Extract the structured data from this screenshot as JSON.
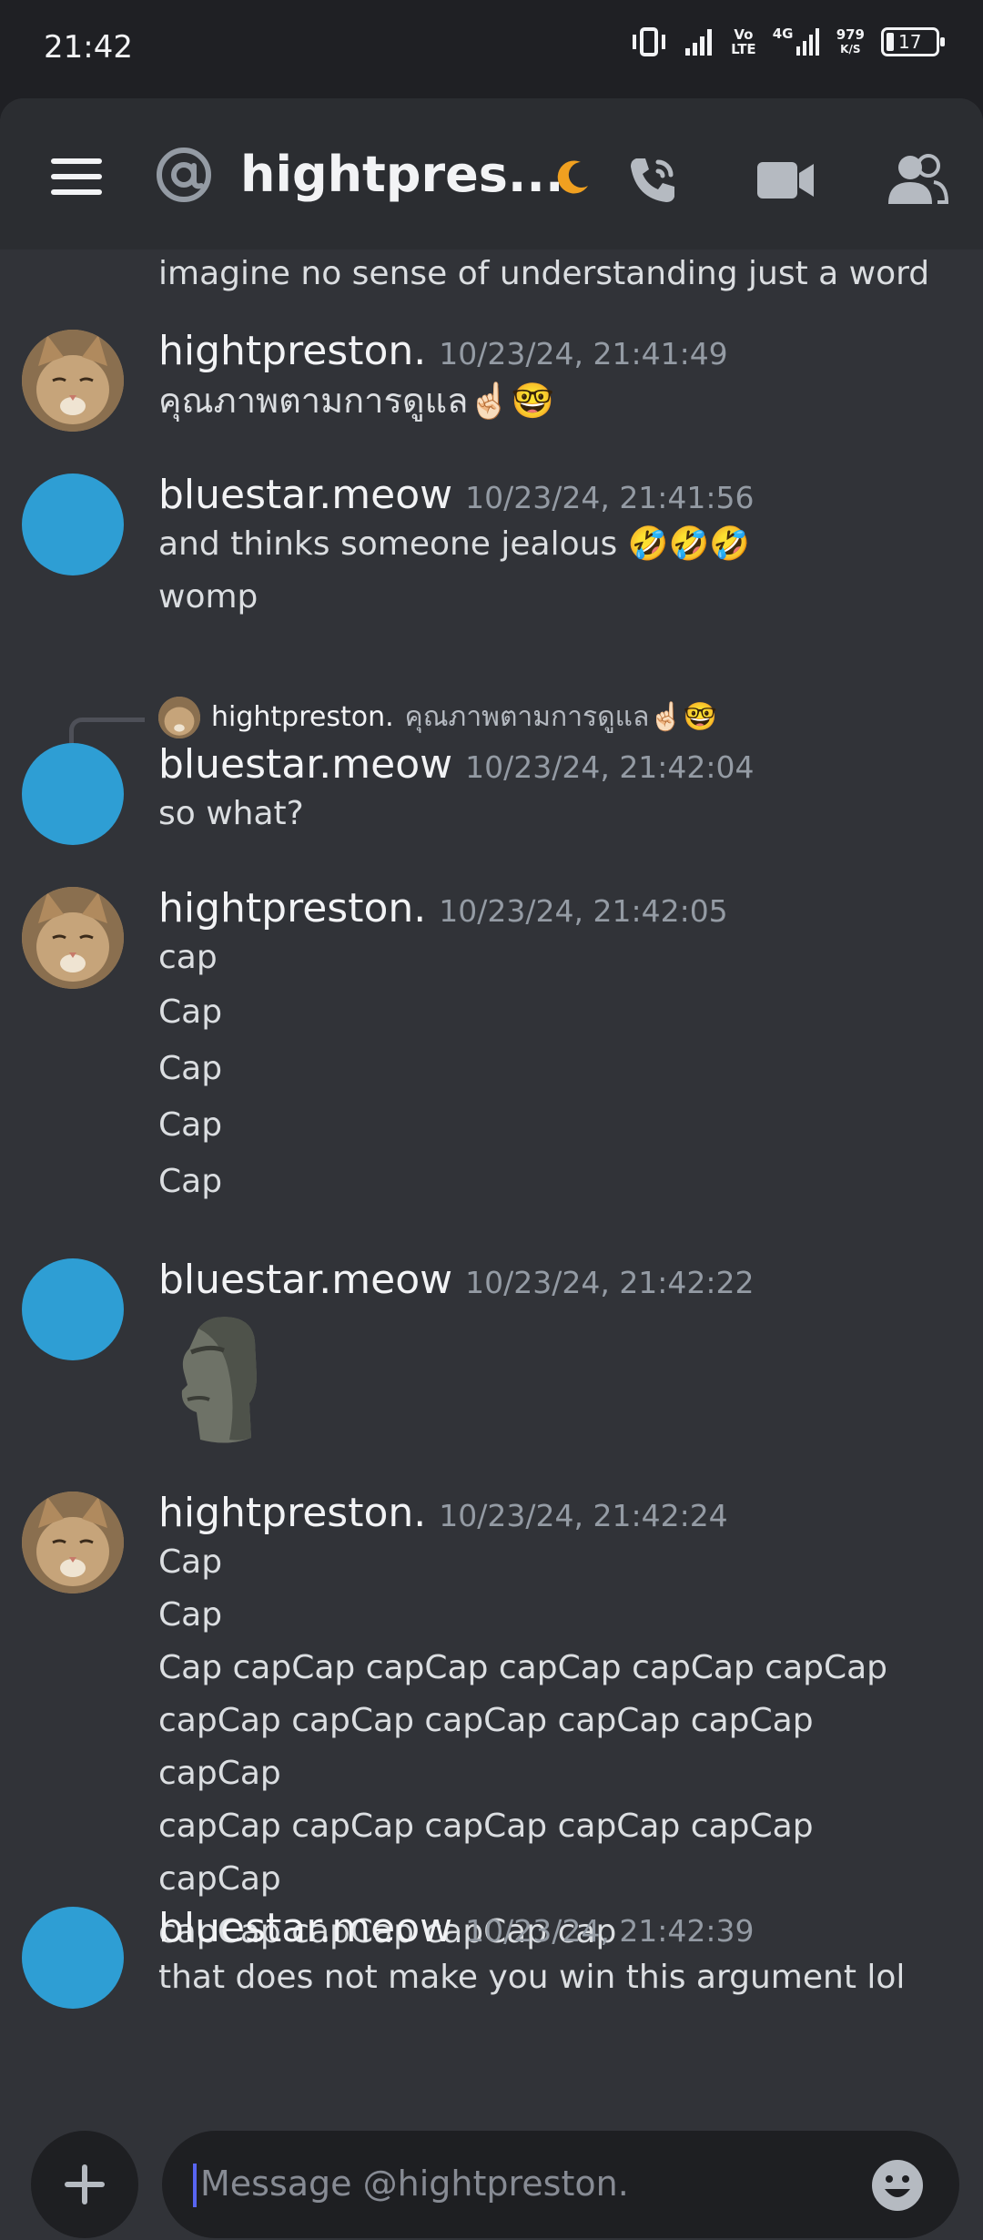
{
  "status": {
    "time": "21:42",
    "volte": "Vo\nLTE",
    "net": "4G",
    "speed_value": "979",
    "speed_unit": "K/S",
    "battery": "17"
  },
  "header": {
    "channel": "hightpres...",
    "icons": [
      "menu-icon",
      "at-icon",
      "moon-icon",
      "call-icon",
      "video-icon",
      "members-icon"
    ]
  },
  "messages": {
    "top_line": "imagine no sense of understanding just a word",
    "m1": {
      "user": "hightpreston.",
      "time": "10/23/24, 21:41:49",
      "lines": [
        "คุณภาพตามการดูแล☝🏻🤓"
      ]
    },
    "m2": {
      "user": "bluestar.meow",
      "time": "10/23/24, 21:41:56",
      "lines": [
        "and thinks someone jealous 🤣🤣🤣",
        "womp"
      ]
    },
    "m3": {
      "reply_user": "hightpreston.",
      "reply_text": "คุณภาพตามการดูแล☝🏻🤓",
      "user": "bluestar.meow",
      "time": "10/23/24, 21:42:04",
      "lines": [
        "so what?"
      ]
    },
    "m4": {
      "user": "hightpreston.",
      "time": "10/23/24, 21:42:05",
      "lines": [
        "cap",
        "Cap",
        "Cap",
        "Cap",
        "Cap"
      ]
    },
    "m5": {
      "user": "bluestar.meow",
      "time": "10/23/24, 21:42:22",
      "sticker": "moai-emoji"
    },
    "m6": {
      "user": "hightpreston.",
      "time": "10/23/24, 21:42:24",
      "lines": [
        "Cap",
        "Cap",
        "Cap capCap capCap capCap capCap capCap",
        "capCap capCap capCap capCap capCap capCap",
        "capCap capCap capCap capCap capCap capCap",
        "capCap capCap capCap cap"
      ]
    },
    "m7": {
      "user": "bluestar.meow",
      "time": "10/23/24, 21:42:39",
      "lines": [
        "that does not make you win this argument lol"
      ]
    }
  },
  "composer": {
    "placeholder": "Message @hightpreston."
  },
  "colors": {
    "background": "#313338",
    "header": "#2b2d31",
    "accent": "#5865f2",
    "avatar_blue": "#2e9ed4",
    "moon": "#f0a020"
  }
}
